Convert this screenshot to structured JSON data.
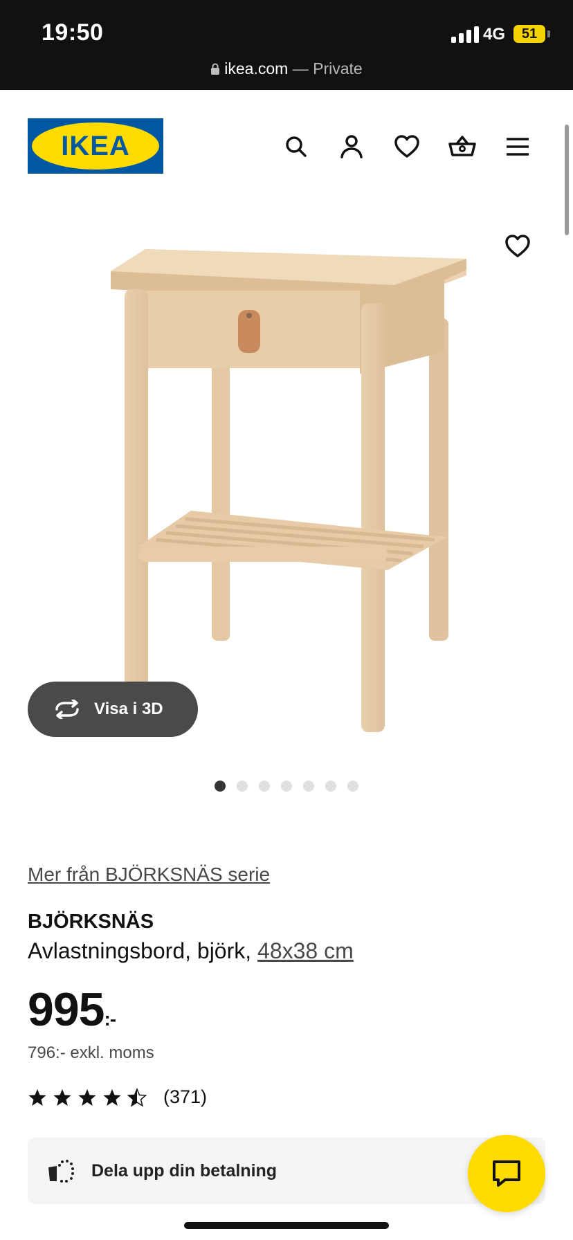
{
  "status_bar": {
    "time": "19:50",
    "network": "4G",
    "battery": "51"
  },
  "browser": {
    "domain": "ikea.com",
    "separator": " — ",
    "mode": "Private"
  },
  "header": {
    "brand": "IKEA",
    "brand_colors": {
      "blue": "#0058A3",
      "yellow": "#FFDB00"
    },
    "icons": [
      "search-icon",
      "account-icon",
      "favourites-icon",
      "basket-icon",
      "menu-icon"
    ]
  },
  "gallery": {
    "view_3d_label": "Visa i 3D",
    "image_count": 7,
    "active_index": 0
  },
  "product": {
    "series_link": "Mer från BJÖRKSNÄS serie",
    "name": "BJÖRKSNÄS",
    "description": "Avlastningsbord, björk, ",
    "size_link": "48x38 cm",
    "price": "995",
    "price_suffix": ":-",
    "price_excl_vat": "796:- exkl. moms",
    "rating": 4.5,
    "rating_max": 5,
    "review_count": "(371)"
  },
  "payment_banner": {
    "label": "Dela upp din betalning"
  },
  "chat": {
    "icon": "chat-icon",
    "color": "#FFDB00"
  }
}
